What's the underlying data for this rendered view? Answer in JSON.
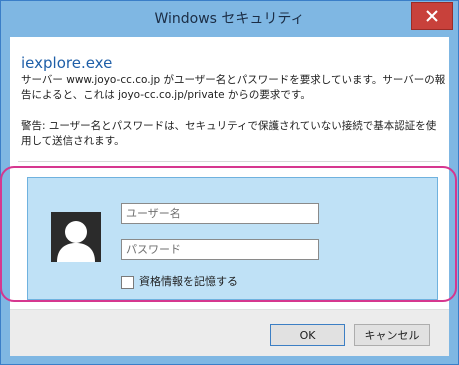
{
  "window": {
    "title": "Windows セキュリティ",
    "close_icon": "close-icon"
  },
  "dialog": {
    "app_name": "iexplore.exe",
    "message": "サーバー www.joyo-cc.co.jp がユーザー名とパスワードを要求しています。サーバーの報告によると、これは joyo-cc.co.jp/private からの要求です。",
    "warning": "警告: ユーザー名とパスワードは、セキュリティで保護されていない接続で基本認証を使用して送信されます。"
  },
  "credentials": {
    "avatar_icon": "user-icon",
    "username_placeholder": "ユーザー名",
    "password_placeholder": "パスワード",
    "remember_label": "資格情報を記憶する",
    "remember_checked": false
  },
  "buttons": {
    "ok_label": "OK",
    "cancel_label": "キャンセル"
  },
  "colors": {
    "titlebar": "#7fb7e3",
    "close": "#c8413b",
    "panel": "#bfe1f6",
    "highlight": "#d6378f"
  }
}
